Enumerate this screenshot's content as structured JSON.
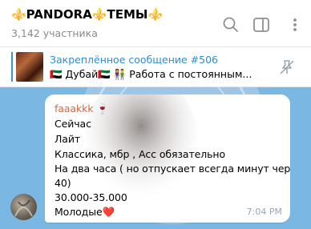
{
  "header": {
    "title": "⚜️PANDORA⚜️ТЕМЫ⚜️",
    "subtitle": "3,142 участника"
  },
  "pinned": {
    "title": "Закреплённое сообщение #506",
    "text": "🇦🇪 Дубай🇦🇪 👫 Работа с постоянным..."
  },
  "message": {
    "sender": "faaakkk 🍷",
    "lines": [
      "Сейчас",
      "Лайт",
      "Классика, мбр , Асс обязательно",
      "На два часа ( но отпускает всегда минут через",
      "40)",
      "30.000-35.000",
      "Молодые❤️"
    ],
    "time": "7:04 PM"
  },
  "icons": [
    "search-icon",
    "sidebar-panel-icon",
    "more-vertical-icon",
    "unpin-icon"
  ],
  "colors": {
    "chat_bg": "#7bb7e3",
    "accent": "#3a95d5",
    "sender": "#d4663a"
  }
}
